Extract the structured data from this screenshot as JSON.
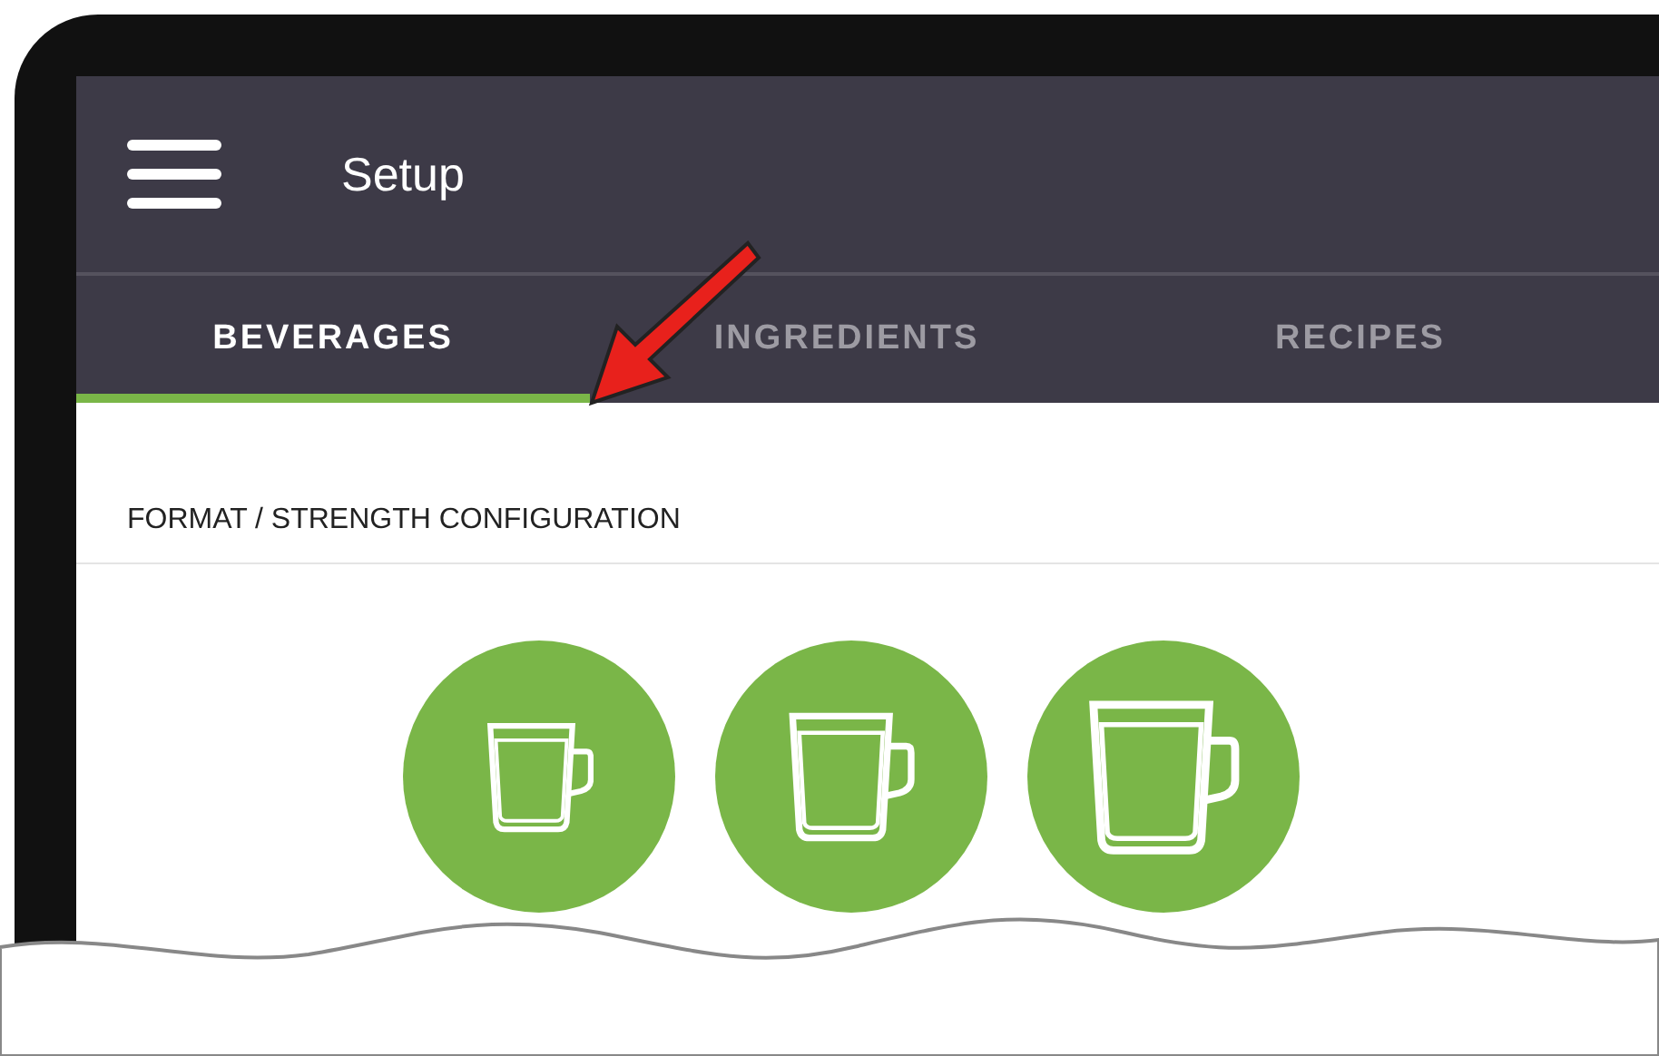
{
  "header": {
    "title": "Setup"
  },
  "tabs": [
    {
      "label": "BEVERAGES",
      "selected": true
    },
    {
      "label": "INGREDIENTS",
      "selected": false
    },
    {
      "label": "RECIPES",
      "selected": false
    }
  ],
  "section": {
    "title": "FORMAT / STRENGTH CONFIGURATION"
  },
  "formats": [
    {
      "kind": "small"
    },
    {
      "kind": "medium"
    },
    {
      "kind": "large"
    }
  ]
}
